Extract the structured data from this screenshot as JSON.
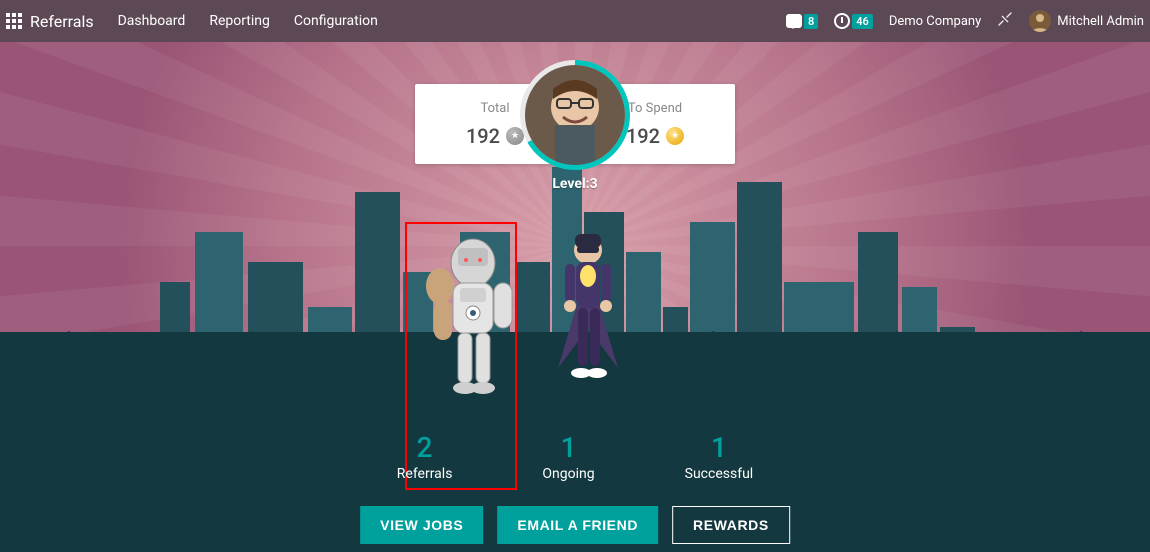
{
  "nav": {
    "app_title": "Referrals",
    "links": [
      "Dashboard",
      "Reporting",
      "Configuration"
    ],
    "messages_badge": "8",
    "activities_badge": "46",
    "company": "Demo Company",
    "user_name": "Mitchell Admin"
  },
  "score": {
    "total_label": "Total",
    "total_value": "192",
    "spend_label": "To Spend",
    "spend_value": "192",
    "level_text": "Level:3"
  },
  "stats": {
    "referrals": {
      "value": "2",
      "label": "Referrals"
    },
    "ongoing": {
      "value": "1",
      "label": "Ongoing"
    },
    "successful": {
      "value": "1",
      "label": "Successful"
    }
  },
  "buttons": {
    "view_jobs": "VIEW JOBS",
    "email_friend": "EMAIL A FRIEND",
    "rewards": "REWARDS"
  }
}
